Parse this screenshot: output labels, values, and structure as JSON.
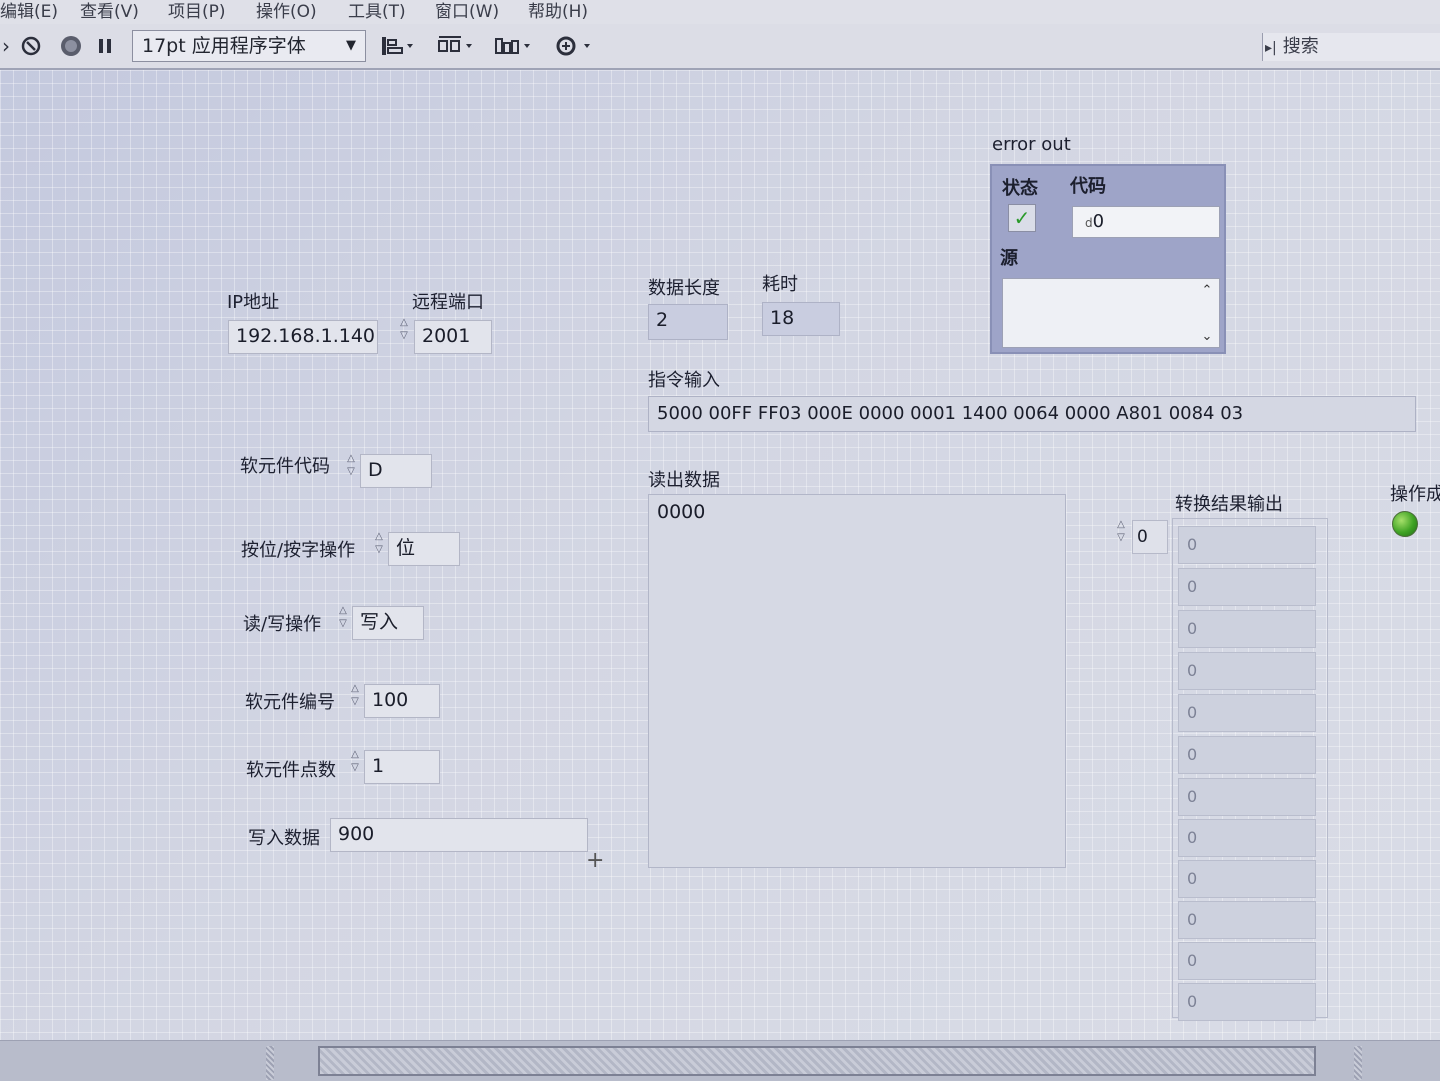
{
  "menu": [
    "编辑(E)",
    "查看(V)",
    "项目(P)",
    "操作(O)",
    "工具(T)",
    "窗口(W)",
    "帮助(H)"
  ],
  "toolbar": {
    "font_select": "17pt 应用程序字体",
    "search_placeholder": "搜索",
    "icons": [
      "run-continuous-icon",
      "abort-icon",
      "pause-icon",
      "align-icon",
      "distribute-icon",
      "resize-icon",
      "reorder-icon"
    ]
  },
  "ip": {
    "label": "IP地址",
    "value": "192.168.1.140"
  },
  "port": {
    "label": "远程端口",
    "value": "2001"
  },
  "data_length": {
    "label": "数据长度",
    "value": "2"
  },
  "elapsed": {
    "label": "耗时",
    "value": "18"
  },
  "error_out": {
    "title": "error out",
    "status_label": "状态",
    "code_label": "代码",
    "code_prefix": "d",
    "code_value": "0",
    "source_label": "源",
    "status_glyph": "✓"
  },
  "command": {
    "label": "指令输入",
    "value": "5000 00FF FF03 000E 0000 0001 1400 0064 0000 A801 0084 03"
  },
  "read_data": {
    "label": "读出数据",
    "value": "0000"
  },
  "device_code": {
    "label": "软元件代码",
    "value": "D"
  },
  "bit_word": {
    "label": "按位/按字操作",
    "value": "位"
  },
  "read_write": {
    "label": "读/写操作",
    "value": "写入"
  },
  "device_number": {
    "label": "软元件编号",
    "value": "100"
  },
  "device_count": {
    "label": "软元件点数",
    "value": "1"
  },
  "write_data": {
    "label": "写入数据",
    "value": "900"
  },
  "convert_output": {
    "label": "转换结果输出",
    "index": "0",
    "values": [
      "0",
      "0",
      "0",
      "0",
      "0",
      "0",
      "0",
      "0",
      "0",
      "0",
      "0",
      "0"
    ]
  },
  "op_done": {
    "label": "操作成"
  },
  "colors": {
    "canvas": "#cbcfe0",
    "error_cluster": "#9ea4c8",
    "led": "#3fa324"
  }
}
